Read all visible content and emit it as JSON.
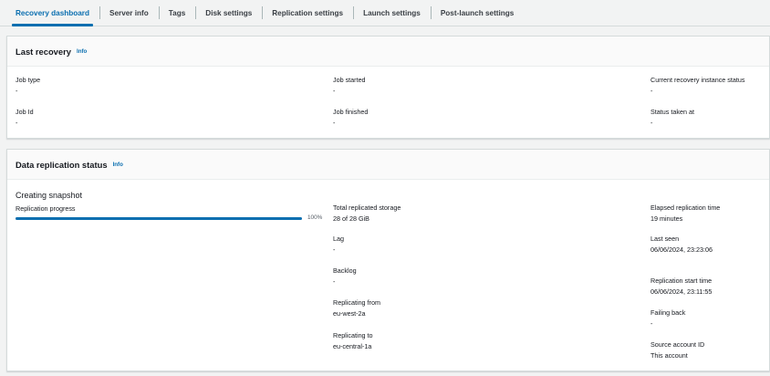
{
  "tabs": [
    {
      "label": "Recovery dashboard",
      "active": true
    },
    {
      "label": "Server info",
      "active": false
    },
    {
      "label": "Tags",
      "active": false
    },
    {
      "label": "Disk settings",
      "active": false
    },
    {
      "label": "Replication settings",
      "active": false
    },
    {
      "label": "Launch settings",
      "active": false
    },
    {
      "label": "Post-launch settings",
      "active": false
    }
  ],
  "last_recovery": {
    "title": "Last recovery",
    "info": "Info",
    "job_type": {
      "label": "Job type",
      "value": "-"
    },
    "job_started": {
      "label": "Job started",
      "value": "-"
    },
    "current_status": {
      "label": "Current recovery instance status",
      "value": "-"
    },
    "job_id": {
      "label": "Job Id",
      "value": "-"
    },
    "job_finished": {
      "label": "Job finished",
      "value": "-"
    },
    "status_taken_at": {
      "label": "Status taken at",
      "value": "-"
    }
  },
  "data_replication": {
    "title": "Data replication status",
    "info": "Info",
    "state": "Creating snapshot",
    "progress_label": "Replication progress",
    "progress_percent": 100,
    "progress_text": "100%",
    "total_storage": {
      "label": "Total replicated storage",
      "value": "28 of 28 GiB"
    },
    "lag": {
      "label": "Lag",
      "value": "-"
    },
    "backlog": {
      "label": "Backlog",
      "value": "-"
    },
    "replicating_from": {
      "label": "Replicating from",
      "value": "eu-west-2a"
    },
    "replicating_to": {
      "label": "Replicating to",
      "value": "eu-central-1a"
    },
    "elapsed_time": {
      "label": "Elapsed replication time",
      "value": "19 minutes"
    },
    "last_seen": {
      "label": "Last seen",
      "value": "06/06/2024, 23:23:06"
    },
    "start_time": {
      "label": "Replication start time",
      "value": "06/06/2024, 23:11:55"
    },
    "failing_back": {
      "label": "Failing back",
      "value": "-"
    },
    "source_account": {
      "label": "Source account ID",
      "value": "This account"
    }
  },
  "colors": {
    "accent": "#0b6fb0",
    "background": "#f2f3f3"
  }
}
